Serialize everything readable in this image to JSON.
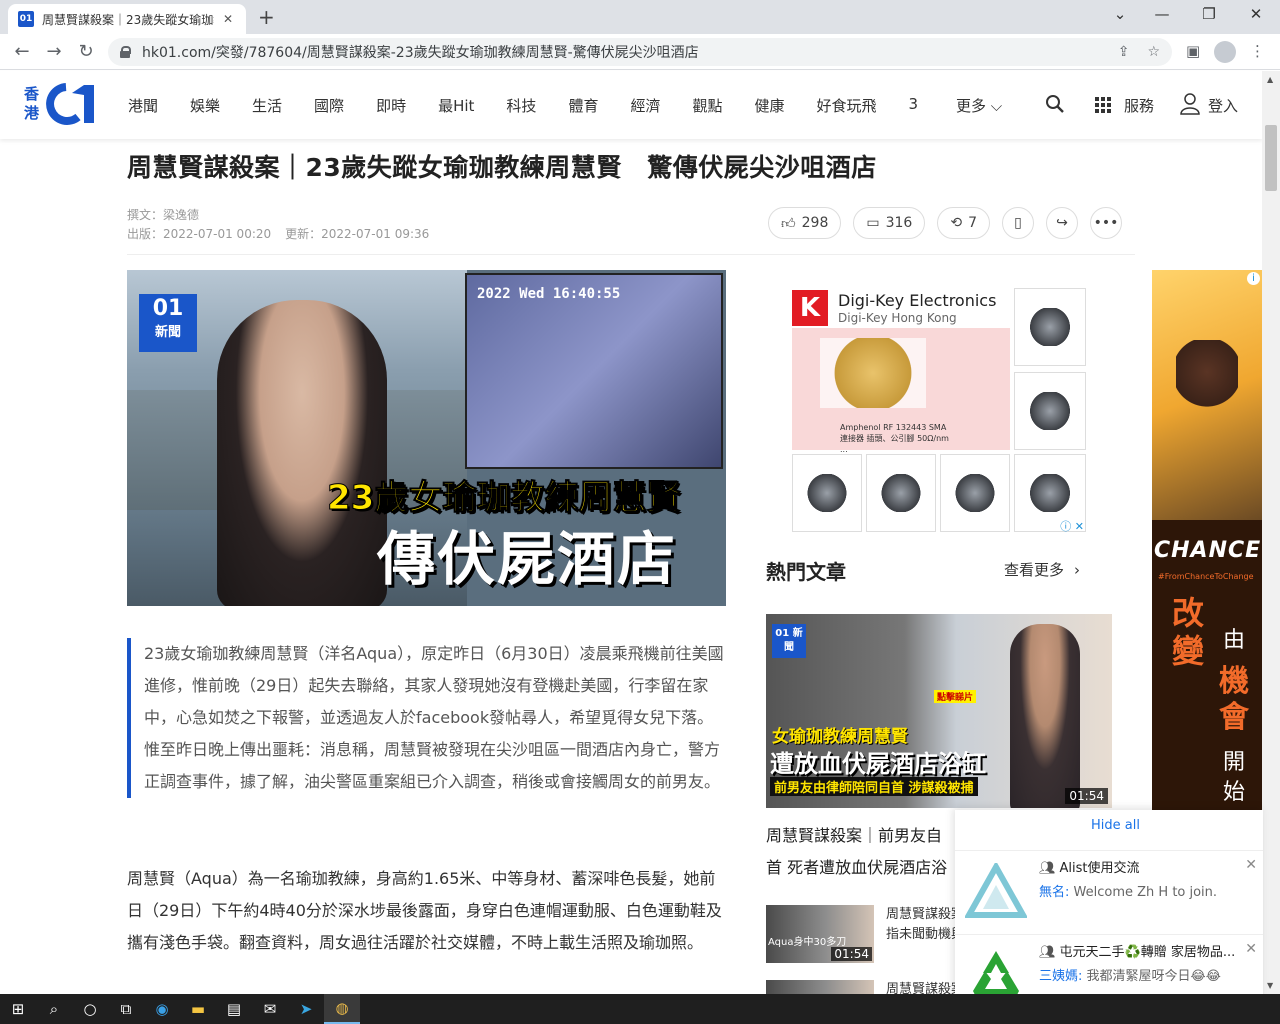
{
  "browser": {
    "tab_title": "周慧賢謀殺案｜23歲失蹤女瑜珈教練周慧賢 驚傳伏屍尖沙咀酒店",
    "favicon_text": "01",
    "url": "hk01.com/突發/787604/周慧賢謀殺案-23歲失蹤女瑜珈教練周慧賢-驚傳伏屍尖沙咀酒店"
  },
  "site": {
    "logo_hk": "香港",
    "nav": [
      "港聞",
      "娛樂",
      "生活",
      "國際",
      "即時",
      "最Hit",
      "科技",
      "體育",
      "經濟",
      "觀點",
      "健康",
      "好食玩飛",
      "3"
    ],
    "more_label": "更多",
    "services_label": "服務",
    "login_label": "登入"
  },
  "article": {
    "headline": "周慧賢謀殺案｜23歲失蹤女瑜珈教練周慧賢　驚傳伏屍尖沙咀酒店",
    "author": "撰文：梁逸德",
    "published": "出版：2022-07-01 00:20",
    "updated": "更新：2022-07-01 09:36",
    "likes": "298",
    "comments": "316",
    "shares": "7",
    "hero": {
      "badge_top": "01",
      "badge_bottom": "新聞",
      "cctv_timestamp": "2022 Wed 16:40:55",
      "caption_line1": "23歲女瑜珈教練周慧賢",
      "caption_line2": "傳伏屍酒店"
    },
    "lead": "23歲女瑜珈教練周慧賢（洋名Aqua），原定昨日（6月30日）凌晨乘飛機前往美國進修，惟前晚（29日）起失去聯絡，其家人發現她沒有登機赴美國，行李留在家中，心急如焚之下報警，並透過友人於facebook發帖尋人，希望覓得女兒下落。惟至昨日晚上傳出噩耗：消息稱，周慧賢被發現在尖沙咀區一間酒店內身亡，警方正調查事件，據了解，油尖警區重案組已介入調查，稍後或會接觸周女的前男友。",
    "body": "周慧賢（Aqua）為一名瑜珈教練，身高約1.65米、中等身材、蓄深啡色長髮，她前日（29日）下午約4時40分於深水埗最後露面，身穿白色連帽運動服、白色運動鞋及攜有淺色手袋。翻查資料，周女過往活躍於社交媒體，不時上載生活照及瑜珈照。"
  },
  "ad": {
    "brand": "Digi-Key Electronics",
    "sub": "Digi-Key Hong Kong",
    "product_desc": "Amphenol RF 132443 SMA 連接器 插頭、公引腳 50Ω/nm ..."
  },
  "hot": {
    "title": "熱門文章",
    "more": "查看更多",
    "feature": {
      "badge": "01 新聞",
      "click_tag": "點擊睇片",
      "line1": "女瑜珈教練周慧賢",
      "line2": "遭放血伏屍酒店浴缸",
      "line3": "前男友由律師陪同自首 涉謀殺被捕",
      "duration": "01:54",
      "caption": "周慧賢謀殺案｜前男友自首 死者遭放血伏屍酒店浴缸"
    },
    "items": [
      {
        "thumb_caption": "Aqua身中30多刀",
        "duration": "01:54",
        "title": "周慧賢謀殺案｜身中30多刀隱命 警",
        "title2": "指未聞動機與「接客」有關"
      },
      {
        "thumb_caption": "",
        "duration": "",
        "title": "周慧賢謀殺案",
        "title2": ""
      }
    ]
  },
  "banner": {
    "chance": "CHANCE",
    "tag": "#FromChanceToChange",
    "word1": "改變",
    "word2": "由",
    "word3": "機會",
    "word4": "開始"
  },
  "notifications": {
    "hide_all": "Hide all",
    "items": [
      {
        "title": "Alist使用交流",
        "sender": "無名:",
        "message": "Welcome Zh H to join."
      },
      {
        "title": "屯元天二手♻️轉贈 家居物品...",
        "sender": "三姨媽:",
        "message": "我都清緊屋呀今日😂😂"
      }
    ]
  },
  "colors": {
    "brand_blue": "#1a56c9",
    "ad_red": "#e21c24",
    "banner_orange": "#f26b2a"
  }
}
